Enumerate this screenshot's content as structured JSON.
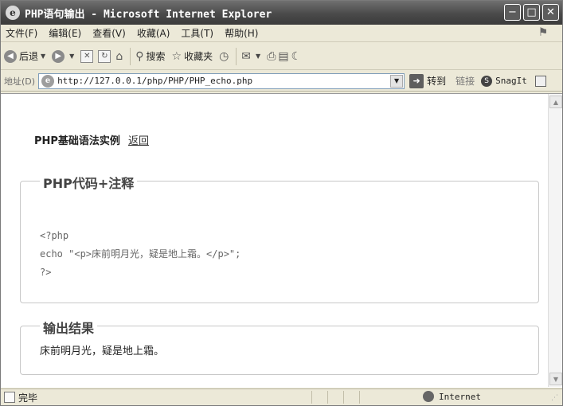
{
  "window": {
    "title": "PHP语句输出 - Microsoft Internet Explorer",
    "title_icon": "ie-icon",
    "controls": [
      "minimize",
      "maximize",
      "close"
    ]
  },
  "menubar": {
    "items": [
      "文件(F)",
      "编辑(E)",
      "查看(V)",
      "收藏(A)",
      "工具(T)",
      "帮助(H)"
    ]
  },
  "toolbar": {
    "back_label": "后退",
    "search_label": "搜索",
    "favorites_label": "收藏夹"
  },
  "address": {
    "label": "地址(D)",
    "url": "http://127.0.0.1/php/PHP/PHP_echo.php",
    "go_label": "转到",
    "links_label": "链接",
    "snagit_label": "SnagIt"
  },
  "page": {
    "title": "PHP基础语法实例",
    "back_link": "返回",
    "code_section": {
      "legend": "PHP代码+注释",
      "lines": [
        "<?php",
        "echo \"<p>床前明月光，疑是地上霜。</p>\";",
        "?>"
      ]
    },
    "output_section": {
      "legend": "输出结果",
      "text": "床前明月光，疑是地上霜。"
    }
  },
  "statusbar": {
    "text": "完毕",
    "zone": "Internet"
  },
  "colors": {
    "titlebar": "#4a4a4a",
    "chrome": "#ece9d8",
    "border": "#c8c8c8"
  }
}
